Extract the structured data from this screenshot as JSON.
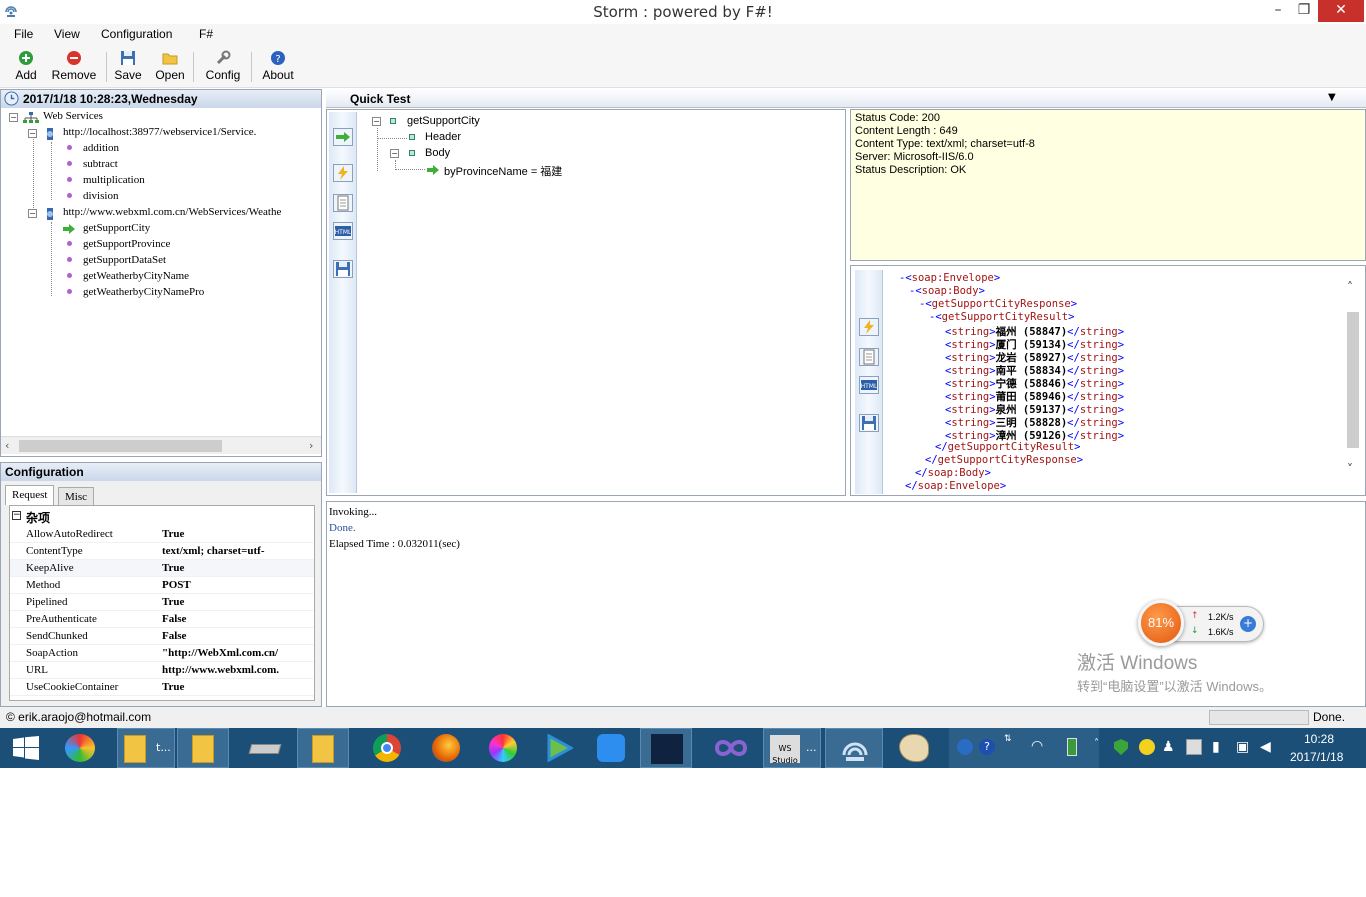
{
  "window": {
    "title": "Storm : powered by F#!",
    "minimize": "–",
    "restore": "❐",
    "close": "✕"
  },
  "menu": [
    "File",
    "View",
    "Configuration",
    "F#"
  ],
  "toolbar": {
    "add": "Add",
    "remove": "Remove",
    "save": "Save",
    "open": "Open",
    "config": "Config",
    "about": "About"
  },
  "left": {
    "header": "2017/1/18 10:28:23,Wednesday",
    "root": "Web Services",
    "service1": {
      "url": "http://localhost:38977/webservice1/Service.",
      "methods": [
        "addition",
        "subtract",
        "multiplication",
        "division"
      ]
    },
    "service2": {
      "url": "http://www.webxml.com.cn/WebServices/Weathe",
      "methods": [
        "getSupportCity",
        "getSupportProvince",
        "getSupportDataSet",
        "getWeatherbyCityName",
        "getWeatherbyCityNamePro"
      ]
    }
  },
  "config": {
    "header": "Configuration",
    "tabs": [
      "Request",
      "Misc"
    ],
    "category": "杂项",
    "properties": [
      {
        "name": "AllowAutoRedirect",
        "value": "True"
      },
      {
        "name": "ContentType",
        "value": "text/xml; charset=utf-"
      },
      {
        "name": "KeepAlive",
        "value": "True"
      },
      {
        "name": "Method",
        "value": "POST"
      },
      {
        "name": "Pipelined",
        "value": "True"
      },
      {
        "name": "PreAuthenticate",
        "value": "False"
      },
      {
        "name": "SendChunked",
        "value": "False"
      },
      {
        "name": "SoapAction",
        "value": "\"http://WebXml.com.cn/"
      },
      {
        "name": "URL",
        "value": "http://www.webxml.com."
      },
      {
        "name": "UseCookieContainer",
        "value": "True"
      }
    ]
  },
  "quicktest": {
    "header": "Quick Test",
    "tree": {
      "root": "getSupportCity",
      "header": "Header",
      "body": "Body",
      "param": "byProvinceName = 福建"
    }
  },
  "status": {
    "lines": [
      "Status Code: 200",
      "Content Length : 649",
      "Content Type: text/xml; charset=utf-8",
      "Server: Microsoft-IIS/6.0",
      "Status Description: OK"
    ]
  },
  "xml": {
    "envelope_open": "soap:Envelope",
    "body_open": "soap:Body",
    "response_open": "getSupportCityResponse",
    "result_open": "getSupportCityResult",
    "strings": [
      "福州 (58847)",
      "厦门 (59134)",
      "龙岩 (58927)",
      "南平 (58834)",
      "宁德 (58846)",
      "莆田 (58946)",
      "泉州 (59137)",
      "三明 (58828)",
      "漳州 (59126)"
    ],
    "string_tag": "string"
  },
  "log": {
    "lines": [
      "Invoking...",
      "Done.",
      "Elapsed Time : 0.032011(sec)"
    ]
  },
  "statusbar": {
    "email": "© erik.araojo@hotmail.com",
    "state": "Done."
  },
  "netwidget": {
    "percent": "81%",
    "up": "1.2K/s",
    "down": "1.6K/s"
  },
  "watermark": {
    "line1": "激活 Windows",
    "line2": "转到“电脑设置”以激活 Windows。"
  },
  "taskbar": {
    "time": "10:28",
    "date": "2017/1/18",
    "folder_label": "t...",
    "ws_label": "WS Studio"
  },
  "colors": {
    "taskbar": "#1b4f77",
    "close": "#c7302b",
    "status_bg": "#ffffe1",
    "xml_tag": "#a31515",
    "xml_bracket": "#0000ff"
  }
}
